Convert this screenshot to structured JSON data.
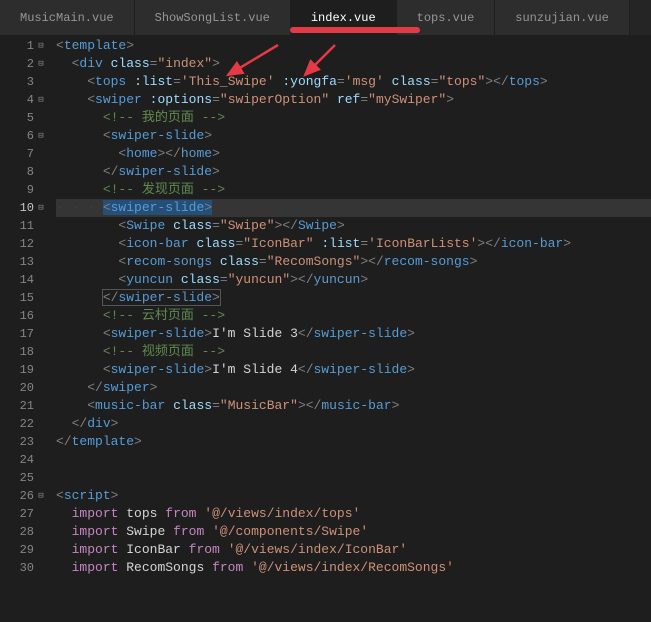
{
  "tabs": [
    {
      "label": "MusicMain.vue"
    },
    {
      "label": "ShowSongList.vue"
    },
    {
      "label": "index.vue",
      "active": true
    },
    {
      "label": "tops.vue"
    },
    {
      "label": "sunzujian.vue"
    }
  ],
  "lines": {
    "l1": {
      "t1": "template"
    },
    "l2": {
      "t1": "div",
      "a1": "class",
      "v1": "index"
    },
    "l3": {
      "t1": "tops",
      "a1": ":list",
      "v1": "This_Swipe",
      "a2": ":yongfa",
      "v2": "msg",
      "a3": "class",
      "v3": "tops",
      "t2": "tops"
    },
    "l4": {
      "t1": "swiper",
      "a1": ":options",
      "v1": "swiperOption",
      "a2": "ref",
      "v2": "mySwiper"
    },
    "l5": {
      "c": "<!-- 我的页面 -->"
    },
    "l6": {
      "t1": "swiper-slide"
    },
    "l7": {
      "t1": "home",
      "t2": "home"
    },
    "l8": {
      "t1": "swiper-slide"
    },
    "l9": {
      "c": "<!-- 发现页面 -->"
    },
    "l10": {
      "t1": "swiper-slide"
    },
    "l11": {
      "t1": "Swipe",
      "a1": "class",
      "v1": "Swipe",
      "t2": "Swipe"
    },
    "l12": {
      "t1": "icon-bar",
      "a1": "class",
      "v1": "IconBar",
      "a2": ":list",
      "v2": "IconBarLists",
      "t2": "icon-bar"
    },
    "l13": {
      "t1": "recom-songs",
      "a1": "class",
      "v1": "RecomSongs",
      "t2": "recom-songs"
    },
    "l14": {
      "t1": "yuncun",
      "a1": "class",
      "v1": "yuncun",
      "t2": "yuncun"
    },
    "l15": {
      "t1": "swiper-slide"
    },
    "l16": {
      "c": "<!-- 云村页面 -->"
    },
    "l17": {
      "t1": "swiper-slide",
      "txt": "I'm Slide 3",
      "t2": "swiper-slide"
    },
    "l18": {
      "c": "<!-- 视频页面 -->"
    },
    "l19": {
      "t1": "swiper-slide",
      "txt": "I'm Slide 4",
      "t2": "swiper-slide"
    },
    "l20": {
      "t1": "swiper"
    },
    "l21": {
      "t1": "music-bar",
      "a1": "class",
      "v1": "MusicBar",
      "t2": "music-bar"
    },
    "l22": {
      "t1": "div"
    },
    "l23": {
      "t1": "template"
    },
    "l26": {
      "t1": "script"
    },
    "l27": {
      "kw": "import",
      "id": "tops",
      "kw2": "from",
      "str": "'@/views/index/tops'"
    },
    "l28": {
      "kw": "import",
      "id": "Swipe",
      "kw2": "from",
      "str": "'@/components/Swipe'"
    },
    "l29": {
      "kw": "import",
      "id": "IconBar",
      "kw2": "from",
      "str": "'@/views/index/IconBar'"
    },
    "l30": {
      "kw": "import",
      "id": "RecomSongs",
      "kw2": "from",
      "str": "'@/views/index/RecomSongs'"
    }
  }
}
